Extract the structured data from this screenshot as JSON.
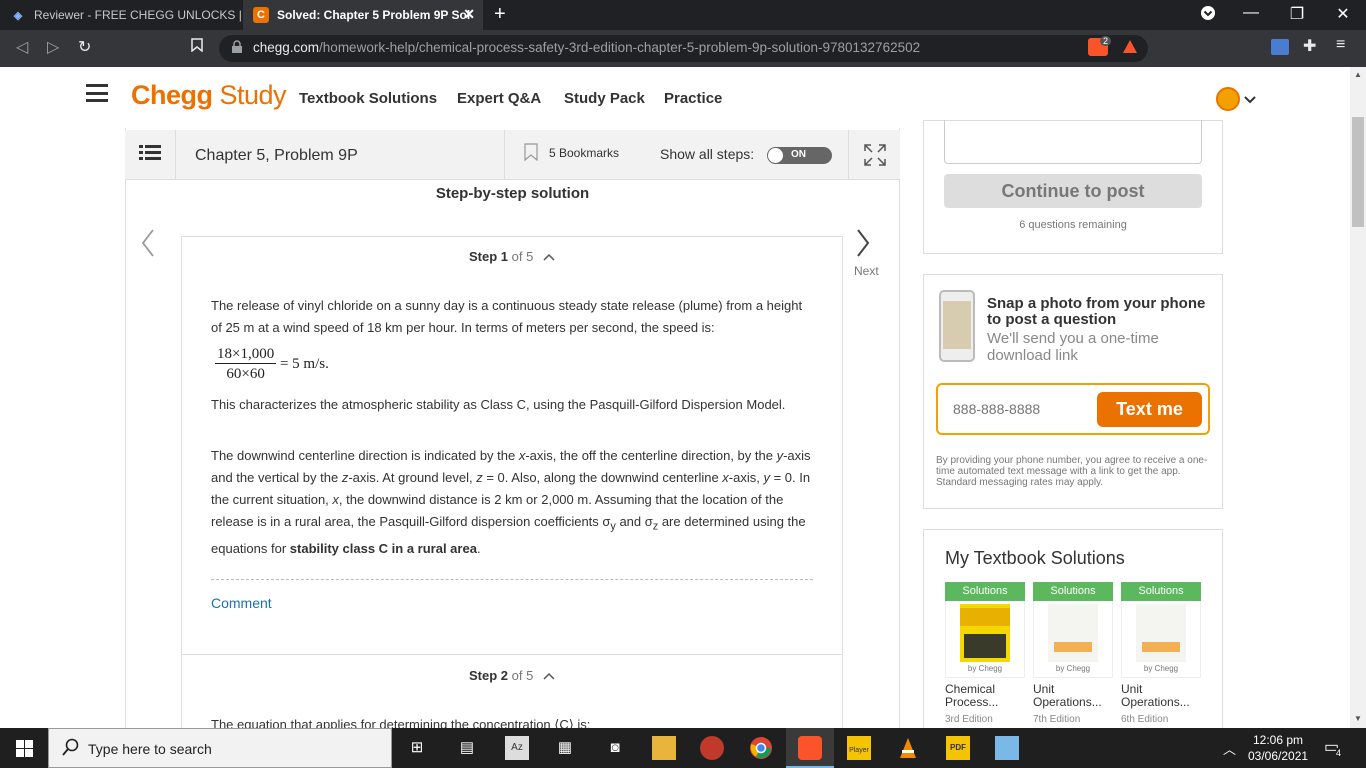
{
  "browser": {
    "tabs": [
      {
        "title": "Reviewer - FREE CHEGG UNLOCKS | Pa",
        "active": false
      },
      {
        "title": "Solved: Chapter 5 Problem 9P Sol",
        "active": true
      }
    ],
    "url_domain": "chegg.com",
    "url_path": "/homework-help/chemical-process-safety-3rd-edition-chapter-5-problem-9p-solution-9780132762502",
    "shield_count": "2"
  },
  "header": {
    "logo_brand": "Chegg",
    "logo_product": "Study",
    "nav": [
      "Textbook Solutions",
      "Expert Q&A",
      "Study Pack",
      "Practice"
    ],
    "accent_color": "#eb7100"
  },
  "toolbar": {
    "chapter_title": "Chapter 5, Problem 9P",
    "bookmarks": "5 Bookmarks",
    "show_all_steps": "Show all steps:",
    "toggle_label": "ON"
  },
  "solution": {
    "heading": "Step-by-step solution",
    "step1_label": "Step 1",
    "step1_of": "of 5",
    "para1": "The release of vinyl chloride on a sunny day is a continuous steady state release (plume) from a height of 25 m at a wind speed of 18 km per hour. In terms of meters per second, the speed is:",
    "eq_numerator": "18×1,000",
    "eq_denominator": "60×60",
    "eq_result": "= 5 m/s.",
    "para2": "This characterizes the atmospheric stability as Class C, using the Pasquill-Gilford Dispersion Model.",
    "para3_a": "The downwind centerline direction is indicated by the ",
    "para3_b": "x",
    "para3_c": "-axis, the off the centerline direction, by the ",
    "para3_d": "y",
    "para3_e": "-axis and the vertical by the ",
    "para3_f": "z",
    "para3_g": "-axis. At ground level, ",
    "para3_h": "z",
    "para3_i": " = 0. Also, along the downwind centerline ",
    "para3_j": "x",
    "para3_k": "-axis, ",
    "para3_l": "y",
    "para3_m": " = 0. In the current situation, ",
    "para3_n": "x",
    "para3_o": ", the downwind distance is 2 km or 2,000 m. Assuming that the location of the release is in a rural area, the Pasquill-Gilford dispersion coefficients σ",
    "para3_p": "y",
    "para3_q": " and σ",
    "para3_r": "z",
    "para3_s": " are determined using the equations for ",
    "para3_bold": "stability class C in a rural area",
    "para3_end": ".",
    "comment": "Comment",
    "step2_label": "Step 2",
    "step2_of": "of 5",
    "para4": "The equation that applies for determining the concentration ⟨C⟩ is:",
    "next_label": "Next"
  },
  "sidebar": {
    "continue_button": "Continue to post",
    "remaining": "6 questions remaining",
    "snap_title": "Snap a photo from your phone to post a question",
    "snap_sub": "We'll send you a one-time download link",
    "phone_placeholder": "888-888-8888",
    "text_me": "Text me",
    "legal": "By providing your phone number, you agree to receive a one-time automated text message with a link to get the app. Standard messaging rates may apply.",
    "my_solutions_title": "My Textbook Solutions",
    "books": [
      {
        "badge": "Solutions",
        "by": "by Chegg",
        "title": "Chemical Process...",
        "edition": "3rd Edition"
      },
      {
        "badge": "Solutions",
        "by": "by Chegg",
        "title": "Unit Operations...",
        "edition": "7th Edition"
      },
      {
        "badge": "Solutions",
        "by": "by Chegg",
        "title": "Unit Operations...",
        "edition": "6th Edition"
      }
    ]
  },
  "taskbar": {
    "search_placeholder": "Type here to search",
    "time": "12:06 pm",
    "date": "03/06/2021",
    "notifications": "4"
  }
}
